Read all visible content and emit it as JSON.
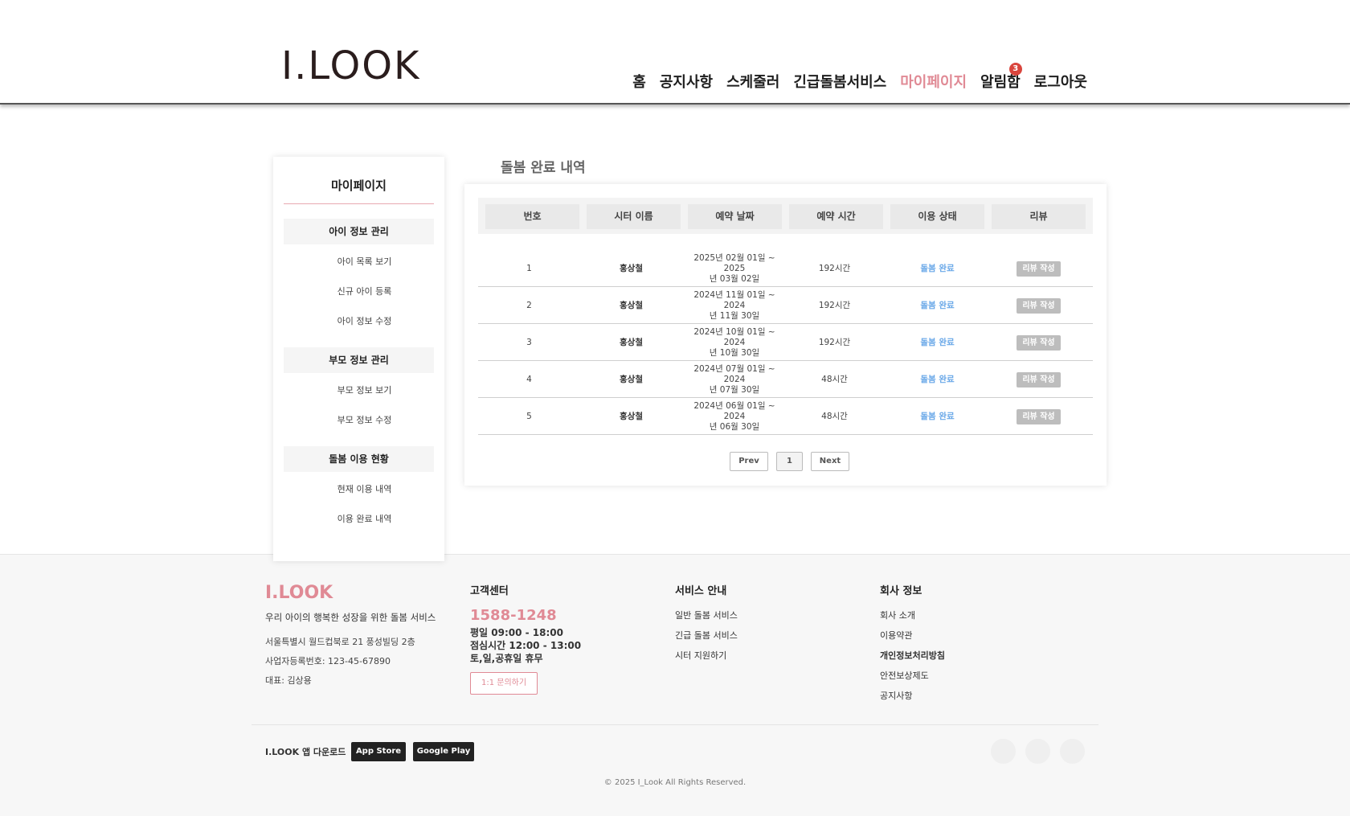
{
  "header": {
    "logo": "I.LOOK",
    "nav": [
      {
        "label": "홈",
        "active": false
      },
      {
        "label": "공지사항",
        "active": false
      },
      {
        "label": "스케줄러",
        "active": false
      },
      {
        "label": "긴급돌봄서비스",
        "active": false
      },
      {
        "label": "마이페이지",
        "active": true
      },
      {
        "label": "알림함",
        "active": false,
        "badge": "3"
      },
      {
        "label": "로그아웃",
        "active": false
      }
    ]
  },
  "sidebar": {
    "title": "마이페이지",
    "groups": [
      {
        "label": "아이 정보 관리",
        "items": [
          "아이 목록 보기",
          "신규 아이 등록",
          "아이 정보 수정"
        ]
      },
      {
        "label": "부모 정보 관리",
        "items": [
          "부모 정보 보기",
          "부모 정보 수정"
        ]
      },
      {
        "label": "돌봄 이용 현황",
        "items": [
          "현재 이용 내역",
          "이용 완료 내역"
        ]
      }
    ]
  },
  "main": {
    "title": "돌봄 완료 내역",
    "columns": [
      "번호",
      "시터 이름",
      "예약 날짜",
      "예약 시간",
      "이용 상태",
      "리뷰"
    ],
    "rows": [
      {
        "no": "1",
        "sitter": "홍상철",
        "date1": "2025년 02월 01일 ~ 2025",
        "date2": "년 03월 02일",
        "time": "192시간",
        "status": "돌봄 완료",
        "review": "리뷰 작성"
      },
      {
        "no": "2",
        "sitter": "홍상철",
        "date1": "2024년 11월 01일 ~ 2024",
        "date2": "년 11월 30일",
        "time": "192시간",
        "status": "돌봄 완료",
        "review": "리뷰 작성"
      },
      {
        "no": "3",
        "sitter": "홍상철",
        "date1": "2024년 10월 01일 ~ 2024",
        "date2": "년 10월 30일",
        "time": "192시간",
        "status": "돌봄 완료",
        "review": "리뷰 작성"
      },
      {
        "no": "4",
        "sitter": "홍상철",
        "date1": "2024년 07월 01일 ~ 2024",
        "date2": "년 07월 30일",
        "time": "48시간",
        "status": "돌봄 완료",
        "review": "리뷰 작성"
      },
      {
        "no": "5",
        "sitter": "홍상철",
        "date1": "2024년 06월 01일 ~ 2024",
        "date2": "년 06월 30일",
        "time": "48시간",
        "status": "돌봄 완료",
        "review": "리뷰 작성"
      }
    ],
    "pager": {
      "prev": "Prev",
      "current": "1",
      "next": "Next"
    }
  },
  "footer": {
    "brand": "I.LOOK",
    "tagline": "우리 아이의 행복한 성장을 위한 돌봄 서비스",
    "address": "서울특별시 월드컵북로 21 풍성빌딩 2층",
    "biz_no": "사업자등록번호: 123-45-67890",
    "ceo": "대표: 김상용",
    "support": {
      "title": "고객센터",
      "phone": "1588-1248",
      "hours1": "평일 09:00 - 18:00",
      "hours2": "점심시간 12:00 - 13:00",
      "hours3": "토,일,공휴일 휴무",
      "inquiry": "1:1 문의하기"
    },
    "services": {
      "title": "서비스 안내",
      "links": [
        "일반 돌봄 서비스",
        "긴급 돌봄 서비스",
        "시터 지원하기"
      ]
    },
    "company": {
      "title": "회사 정보",
      "links": [
        "회사 소개",
        "이용약관",
        "개인정보처리방침",
        "안전보상제도",
        "공지사항"
      ]
    },
    "app_label": "I.LOOK 앱 다운로드",
    "app_store": "App Store",
    "google_play": "Google Play",
    "copyright": "© 2025 I_Look All Rights Reserved."
  }
}
